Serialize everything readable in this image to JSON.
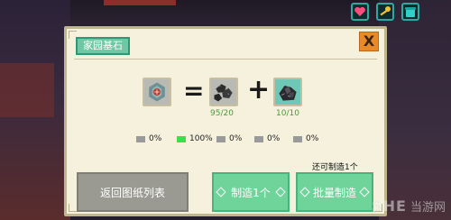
{
  "dialog": {
    "title": "家园基石",
    "close_label": "X"
  },
  "recipe": {
    "equals_symbol": "=",
    "plus_symbol": "+",
    "output_item": "home-cornerstone-icon",
    "ingredients": [
      {
        "icon": "coal-ore-icon",
        "count": "95/20"
      },
      {
        "icon": "dark-crystal-ore-icon",
        "count": "10/10"
      }
    ]
  },
  "chances": [
    {
      "label": "0%",
      "active": false
    },
    {
      "label": "100%",
      "active": true
    },
    {
      "label": "0%",
      "active": false
    },
    {
      "label": "0%",
      "active": false
    },
    {
      "label": "0%",
      "active": false
    }
  ],
  "buttons": {
    "back_label": "返回图纸列表",
    "make_one_label": "制造1个",
    "batch_label": "批量制造"
  },
  "remaining_text": "还可制造1个",
  "top_icons": [
    "heart-icon",
    "key-icon",
    "bag-icon"
  ],
  "watermark": {
    "logo": "SHE",
    "text": "当游网"
  },
  "colors": {
    "panel_bg": "#f5f1dc",
    "title_tab": "#6fc7a3",
    "close_button": "#e98a2a",
    "green_button": "#6fd49a",
    "gray_button": "#9a9a93",
    "count_text": "#4c9a3a",
    "chance_active": "#38e04c"
  }
}
